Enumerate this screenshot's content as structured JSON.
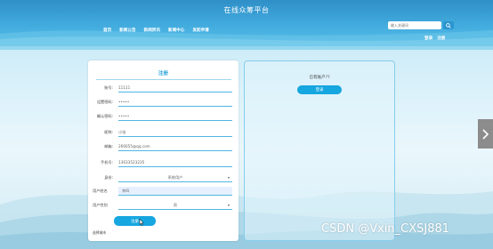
{
  "header": {
    "title": "在线众筹平台",
    "nav": [
      "首页",
      "新闻公告",
      "新闻资讯",
      "新闻中心",
      "发起申请"
    ],
    "search_placeholder": "输入关键词",
    "auth": [
      "登录",
      "注册"
    ]
  },
  "register": {
    "title": "注册",
    "fields": [
      {
        "label": "账号:",
        "value": "11111",
        "type": "text"
      },
      {
        "label": "设置密码:",
        "value": "•••••",
        "type": "text"
      },
      {
        "label": "确认密码:",
        "value": "•••••",
        "type": "text"
      },
      {
        "label": "昵称:",
        "value": "小张",
        "type": "text"
      },
      {
        "label": "邮箱:",
        "value": "266655@qq.com",
        "type": "text"
      },
      {
        "label": "手机号:",
        "value": "13633523235",
        "type": "text"
      },
      {
        "label": "身份:",
        "value": "系统用户",
        "type": "select"
      },
      {
        "label": "用户姓名",
        "value": "李四",
        "type": "filled"
      },
      {
        "label": "用户性别",
        "value": "男",
        "type": "select"
      }
    ],
    "submit_label": "注册",
    "footer_note": "选择城市"
  },
  "side": {
    "has_account_text": "已有账户??",
    "login_label": "登录"
  },
  "watermark": "CSDN @Vxin_CXSJ881",
  "colors": {
    "accent": "#16a6e0",
    "header": "#3a9fd6"
  }
}
